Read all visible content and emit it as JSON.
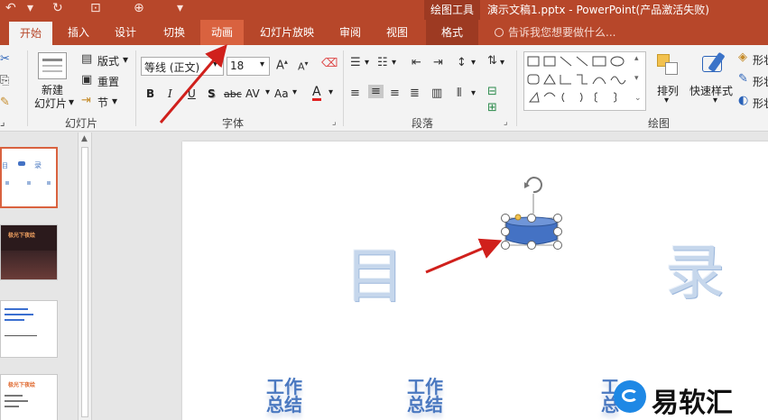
{
  "title_bar": {
    "contextual_tab_group": "绘图工具",
    "document_title": "演示文稿1.pptx - PowerPoint(产品激活失败)"
  },
  "tabs": [
    {
      "label": "开始",
      "state": "active"
    },
    {
      "label": "插入",
      "state": ""
    },
    {
      "label": "设计",
      "state": ""
    },
    {
      "label": "切换",
      "state": ""
    },
    {
      "label": "动画",
      "state": "highlighted"
    },
    {
      "label": "幻灯片放映",
      "state": ""
    },
    {
      "label": "审阅",
      "state": ""
    },
    {
      "label": "视图",
      "state": ""
    },
    {
      "label": "格式",
      "state": "contextual"
    }
  ],
  "tell_me": "告诉我您想要做什么...",
  "ribbon": {
    "slides_group": {
      "label": "幻灯片",
      "new_slide_line1": "新建",
      "new_slide_line2": "幻灯片",
      "layout": "版式",
      "reset": "重置",
      "section": "节"
    },
    "font_group": {
      "label": "字体",
      "font_name": "等线 (正文)",
      "font_size": "18",
      "bold": "B",
      "italic": "I",
      "underline": "U",
      "shadow": "S",
      "strike": "abc",
      "spacing": "AV",
      "case": "Aa",
      "color": "A"
    },
    "paragraph_group": {
      "label": "段落"
    },
    "drawing_group": {
      "label": "绘图",
      "arrange": "排列",
      "quick_styles": "快速样式",
      "shape_fill": "形状",
      "shape_outline": "形状",
      "shape_effect": "形状"
    }
  },
  "slide": {
    "big_chars": [
      "目",
      "录"
    ],
    "wordart": [
      {
        "line1": "工作",
        "line2": "总结"
      },
      {
        "line1": "工作",
        "line2": "总结"
      },
      {
        "line1": "工",
        "line2": "总"
      }
    ]
  },
  "thumbnails": {
    "slide2_title": "极光下夜绘",
    "slide4_title": "极光下夜绘"
  },
  "watermark": "易软汇",
  "colors": {
    "accent": "#b7472a",
    "ribbon_bg": "#f3f3f3",
    "shape_fill": "#4472c4",
    "arrow": "#d0201c"
  }
}
